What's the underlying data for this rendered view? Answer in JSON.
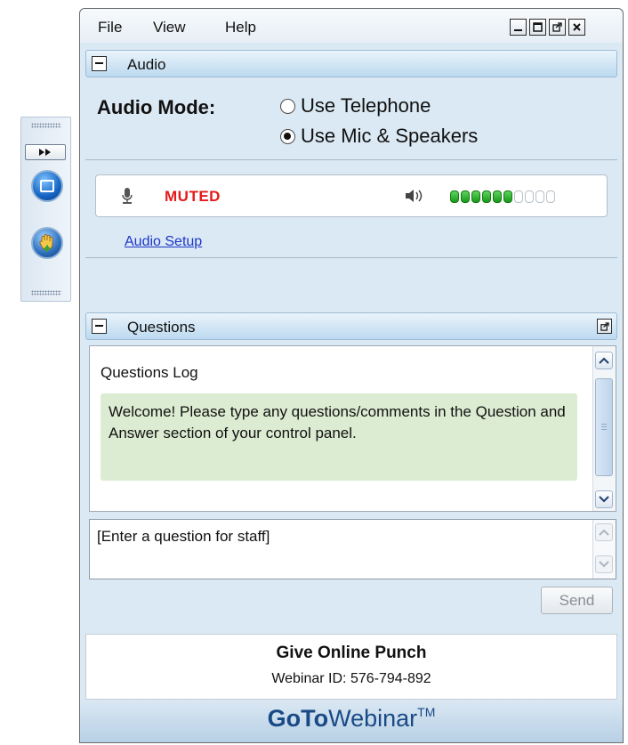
{
  "menu": {
    "file": "File",
    "view": "View",
    "help": "Help"
  },
  "audio": {
    "panel_title": "Audio",
    "mode_label": "Audio Mode:",
    "options": [
      {
        "label": "Use Telephone",
        "selected": false
      },
      {
        "label": "Use Mic & Speakers",
        "selected": true
      }
    ],
    "mic_status": "MUTED",
    "speaker_level": {
      "active": 6,
      "total": 10
    },
    "setup_link": "Audio Setup"
  },
  "questions": {
    "panel_title": "Questions",
    "log_title": "Questions Log",
    "welcome_message": "Welcome! Please type any questions/comments in the Question and Answer section of your control panel.",
    "input_value": "[Enter a question for staff]",
    "send_label": "Send"
  },
  "footer": {
    "organizer": "Give Online Punch",
    "webinar_id": "Webinar ID: 576-794-892",
    "brand_goto": "GoTo",
    "brand_webinar": "Webinar",
    "brand_tm": "TM"
  },
  "colors": {
    "muted": "#e41a1a",
    "link": "#1b35c8",
    "level_on": "#179a17",
    "welcome_bg": "#dcecd2"
  }
}
